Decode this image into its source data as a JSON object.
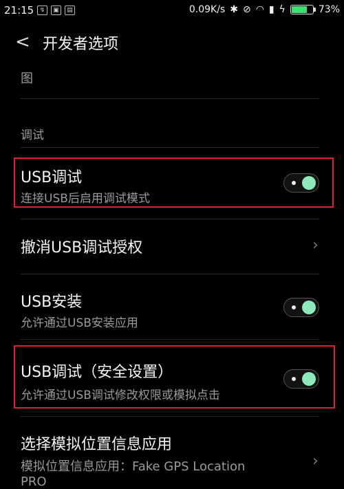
{
  "status_bar": {
    "time": "21:15",
    "net_speed": "0.09K/s",
    "battery": "73%",
    "battery_level": 0.73
  },
  "header": {
    "back_glyph": "<",
    "title": "开发者选项"
  },
  "prev_item_fragment": "图",
  "section_title": "调试",
  "items": [
    {
      "title": "USB调试",
      "subtitle": "连接USB后启用调试模式",
      "toggle_on": true
    },
    {
      "title": "撤消USB调试授权"
    },
    {
      "title": "USB安装",
      "subtitle": "允许通过USB安装应用",
      "toggle_on": true
    },
    {
      "title": "USB调试（安全设置）",
      "subtitle": "允许通过USB调试修改权限或模拟点击",
      "toggle_on": true
    },
    {
      "title": "选择模拟位置信息应用",
      "subtitle_line1": "模拟位置信息应用：Fake GPS Location",
      "subtitle_line2": "PRO"
    }
  ],
  "colors": {
    "highlight": "#e02030",
    "toggle_knob": "#8ee8b9",
    "battery_fill": "#39e26f"
  }
}
